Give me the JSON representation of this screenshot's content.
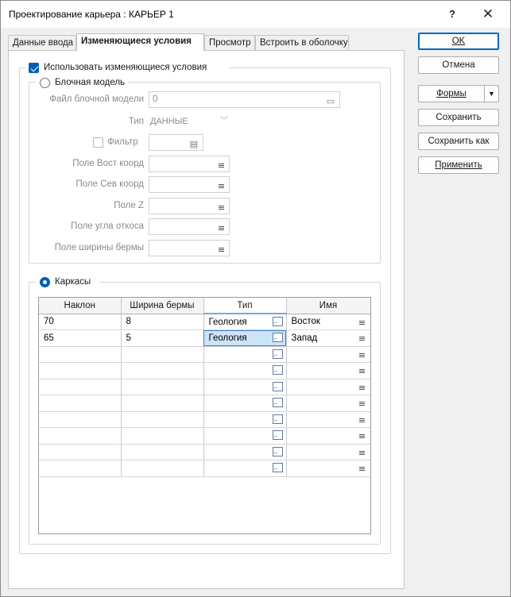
{
  "window": {
    "title": "Проектирование карьера : КАРЬЕР 1",
    "help_label": "?",
    "close_label": "✕"
  },
  "tabs": [
    {
      "label": "Данные ввода",
      "active": false
    },
    {
      "label": "Изменяющиеся условия",
      "active": true
    },
    {
      "label": "Просмотр",
      "active": false
    },
    {
      "label": "Встроить в оболочку",
      "active": false
    }
  ],
  "buttons": {
    "ok": "OK",
    "cancel": "Отмена",
    "forms": "Формы",
    "save": "Сохранить",
    "save_as": "Сохранить как",
    "apply": "Применить"
  },
  "use_conditions": {
    "label": "Использовать изменяющиеся условия",
    "checked": true
  },
  "block_model": {
    "label": "Блочная модель",
    "selected": false,
    "file_label": "Файл блочной модели",
    "file_value": "0",
    "type_label": "Тип",
    "type_value": "ДАННЫЕ",
    "filter_label": "Фильтр",
    "filter_checked": false,
    "east_label": "Поле Вост коорд",
    "north_label": "Поле Сев коорд",
    "z_label": "Поле Z",
    "slope_label": "Поле угла откоса",
    "berm_label": "Поле ширины бермы"
  },
  "wireframes": {
    "label": "Каркасы",
    "selected": true,
    "columns": [
      "Наклон",
      "Ширина бермы",
      "Тип",
      "Имя"
    ],
    "rows": [
      {
        "slope": "70",
        "berm": "8",
        "type": "Геология",
        "name": "Восток"
      },
      {
        "slope": "65",
        "berm": "5",
        "type": "Геология",
        "name": "Запад"
      },
      {
        "slope": "",
        "berm": "",
        "type": "",
        "name": ""
      },
      {
        "slope": "",
        "berm": "",
        "type": "",
        "name": ""
      },
      {
        "slope": "",
        "berm": "",
        "type": "",
        "name": ""
      },
      {
        "slope": "",
        "berm": "",
        "type": "",
        "name": ""
      },
      {
        "slope": "",
        "berm": "",
        "type": "",
        "name": ""
      },
      {
        "slope": "",
        "berm": "",
        "type": "",
        "name": ""
      },
      {
        "slope": "",
        "berm": "",
        "type": "",
        "name": ""
      },
      {
        "slope": "",
        "berm": "",
        "type": "",
        "name": ""
      }
    ]
  }
}
